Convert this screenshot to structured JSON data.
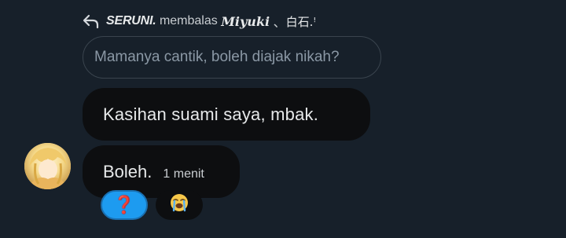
{
  "reply_header": {
    "author": "SERUNI.",
    "action": "membalas",
    "target_user": "Miyuki",
    "separator": "、",
    "tag": "白石.ꜝ"
  },
  "quoted_message": {
    "text": "Mamanya cantik, boleh diajak nikah?"
  },
  "messages": [
    {
      "text": "Kasihan suami saya, mbak."
    },
    {
      "text": "Boleh.",
      "timestamp": "1 menit"
    }
  ],
  "reactions": [
    {
      "icon": "red-question-mark-icon",
      "glyph": "❓",
      "selected": true
    },
    {
      "icon": "loudly-crying-face-icon",
      "glyph": "😭",
      "selected": false
    }
  ],
  "colors": {
    "background": "#17202a",
    "bubble": "#0d0e10",
    "accent": "#1d9bf0",
    "muted_text": "#8b98a5"
  }
}
